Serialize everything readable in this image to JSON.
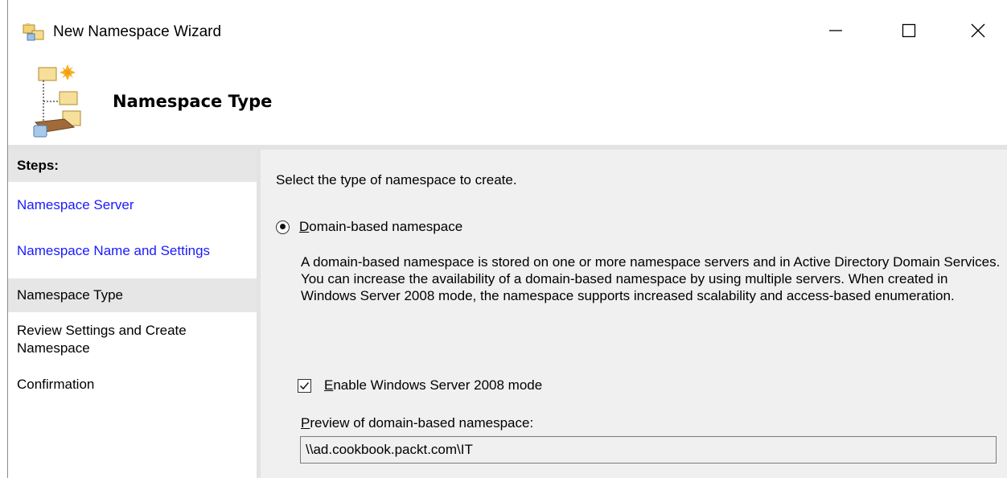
{
  "window": {
    "title": "New Namespace Wizard"
  },
  "header": {
    "title": "Namespace Type"
  },
  "steps": {
    "heading": "Steps:",
    "items": [
      {
        "label": "Namespace Server",
        "state": "link"
      },
      {
        "label": "Namespace Name and Settings",
        "state": "link"
      },
      {
        "label": "Namespace Type",
        "state": "current"
      },
      {
        "label": "Review Settings and Create Namespace",
        "state": "pending"
      },
      {
        "label": "Confirmation",
        "state": "pending"
      }
    ]
  },
  "content": {
    "instruction": "Select the type of namespace to create.",
    "radio_domain": {
      "label_accel": "D",
      "label_rest": "omain-based namespace",
      "selected": true
    },
    "description": "A domain-based namespace is stored on one or more namespace servers and in Active Directory Domain Services. You can increase the availability of a domain-based namespace by using multiple servers. When created in Windows Server 2008 mode, the namespace supports increased scalability and access-based enumeration.",
    "checkbox_2008": {
      "label_accel": "E",
      "label_rest": "nable Windows Server 2008 mode",
      "checked": true
    },
    "preview_label_accel": "P",
    "preview_label_rest": "review of domain-based namespace:",
    "preview_value": "\\\\ad.cookbook.packt.com\\IT"
  },
  "colors": {
    "link": "#1a1aff",
    "panel": "#f0f0f0",
    "steps_highlight": "#e6e6e6"
  },
  "icons": [
    "namespace-folder-icon",
    "namespace-tree-icon",
    "minimize-icon",
    "maximize-icon",
    "close-icon"
  ]
}
